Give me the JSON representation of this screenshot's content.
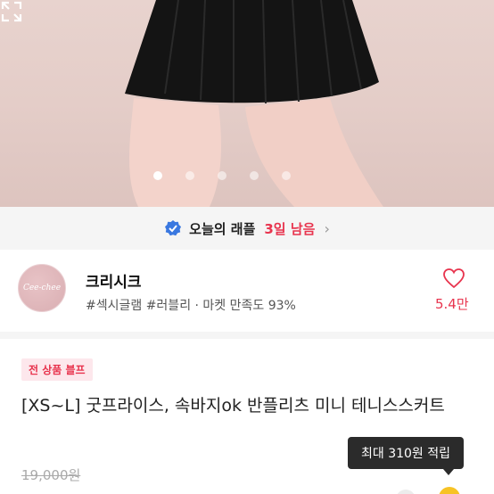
{
  "gallery": {
    "total_images": 5,
    "current_index": 1
  },
  "raffle": {
    "title": "오늘의 래플",
    "days_left": "3일 남음"
  },
  "shop": {
    "logo_text": "Cee-chee",
    "name": "크리시크",
    "tags": "#섹시글램 #러블리 · 마켓 만족도 93%",
    "likes": "5.4만"
  },
  "product": {
    "badge": "전 상품 블프",
    "title": "[XS~L] 굿프라이스, 속바지ok 반플리츠 미니 테니스스커트",
    "original_price": "19,000원"
  },
  "points_tooltip": "최대 310원 적립",
  "colors": {
    "accent": "#e8344e",
    "verified_blue": "#3a78e0"
  }
}
